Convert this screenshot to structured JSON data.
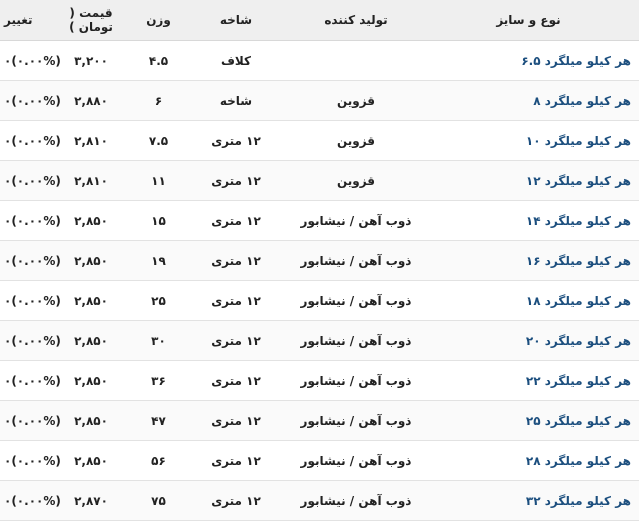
{
  "headers": {
    "name": "نوع و سایز",
    "producer": "تولید کننده",
    "branch": "شاخه",
    "weight": "وزن",
    "price": "قیمت ( تومان )",
    "change": "تغییر"
  },
  "colors": {
    "link": "#1b4e7e",
    "header_bg": "#efefef",
    "row_alt": "#fafafa"
  },
  "rows": [
    {
      "name": "هر کیلو میلگرد ۶.۵",
      "producer": "",
      "branch": "کلاف",
      "weight": "۴.۵",
      "price": "۳,۲۰۰",
      "change": "۰(۰.۰۰%)"
    },
    {
      "name": "هر کیلو میلگرد ۸",
      "producer": "قزوین",
      "branch": "شاخه",
      "weight": "۶",
      "price": "۲,۸۸۰",
      "change": "۰(۰.۰۰%)"
    },
    {
      "name": "هر کیلو میلگرد ۱۰",
      "producer": "قزوین",
      "branch": "۱۲ متری",
      "weight": "۷.۵",
      "price": "۲,۸۱۰",
      "change": "۰(۰.۰۰%)"
    },
    {
      "name": "هر کیلو میلگرد ۱۲",
      "producer": "قزوین",
      "branch": "۱۲ متری",
      "weight": "۱۱",
      "price": "۲,۸۱۰",
      "change": "۰(۰.۰۰%)"
    },
    {
      "name": "هر کیلو میلگرد ۱۴",
      "producer": "ذوب آهن / نیشابور",
      "branch": "۱۲ متری",
      "weight": "۱۵",
      "price": "۲,۸۵۰",
      "change": "۰(۰.۰۰%)"
    },
    {
      "name": "هر کیلو میلگرد ۱۶",
      "producer": "ذوب آهن / نیشابور",
      "branch": "۱۲ متری",
      "weight": "۱۹",
      "price": "۲,۸۵۰",
      "change": "۰(۰.۰۰%)"
    },
    {
      "name": "هر کیلو میلگرد ۱۸",
      "producer": "ذوب آهن / نیشابور",
      "branch": "۱۲ متری",
      "weight": "۲۵",
      "price": "۲,۸۵۰",
      "change": "۰(۰.۰۰%)"
    },
    {
      "name": "هر کیلو میلگرد ۲۰",
      "producer": "ذوب آهن / نیشابور",
      "branch": "۱۲ متری",
      "weight": "۳۰",
      "price": "۲,۸۵۰",
      "change": "۰(۰.۰۰%)"
    },
    {
      "name": "هر کیلو میلگرد ۲۲",
      "producer": "ذوب آهن / نیشابور",
      "branch": "۱۲ متری",
      "weight": "۳۶",
      "price": "۲,۸۵۰",
      "change": "۰(۰.۰۰%)"
    },
    {
      "name": "هر کیلو میلگرد ۲۵",
      "producer": "ذوب آهن / نیشابور",
      "branch": "۱۲ متری",
      "weight": "۴۷",
      "price": "۲,۸۵۰",
      "change": "۰(۰.۰۰%)"
    },
    {
      "name": "هر کیلو میلگرد ۲۸",
      "producer": "ذوب آهن / نیشابور",
      "branch": "۱۲ متری",
      "weight": "۵۶",
      "price": "۲,۸۵۰",
      "change": "۰(۰.۰۰%)"
    },
    {
      "name": "هر کیلو میلگرد ۳۲",
      "producer": "ذوب آهن / نیشابور",
      "branch": "۱۲ متری",
      "weight": "۷۵",
      "price": "۲,۸۷۰",
      "change": "۰(۰.۰۰%)"
    }
  ]
}
